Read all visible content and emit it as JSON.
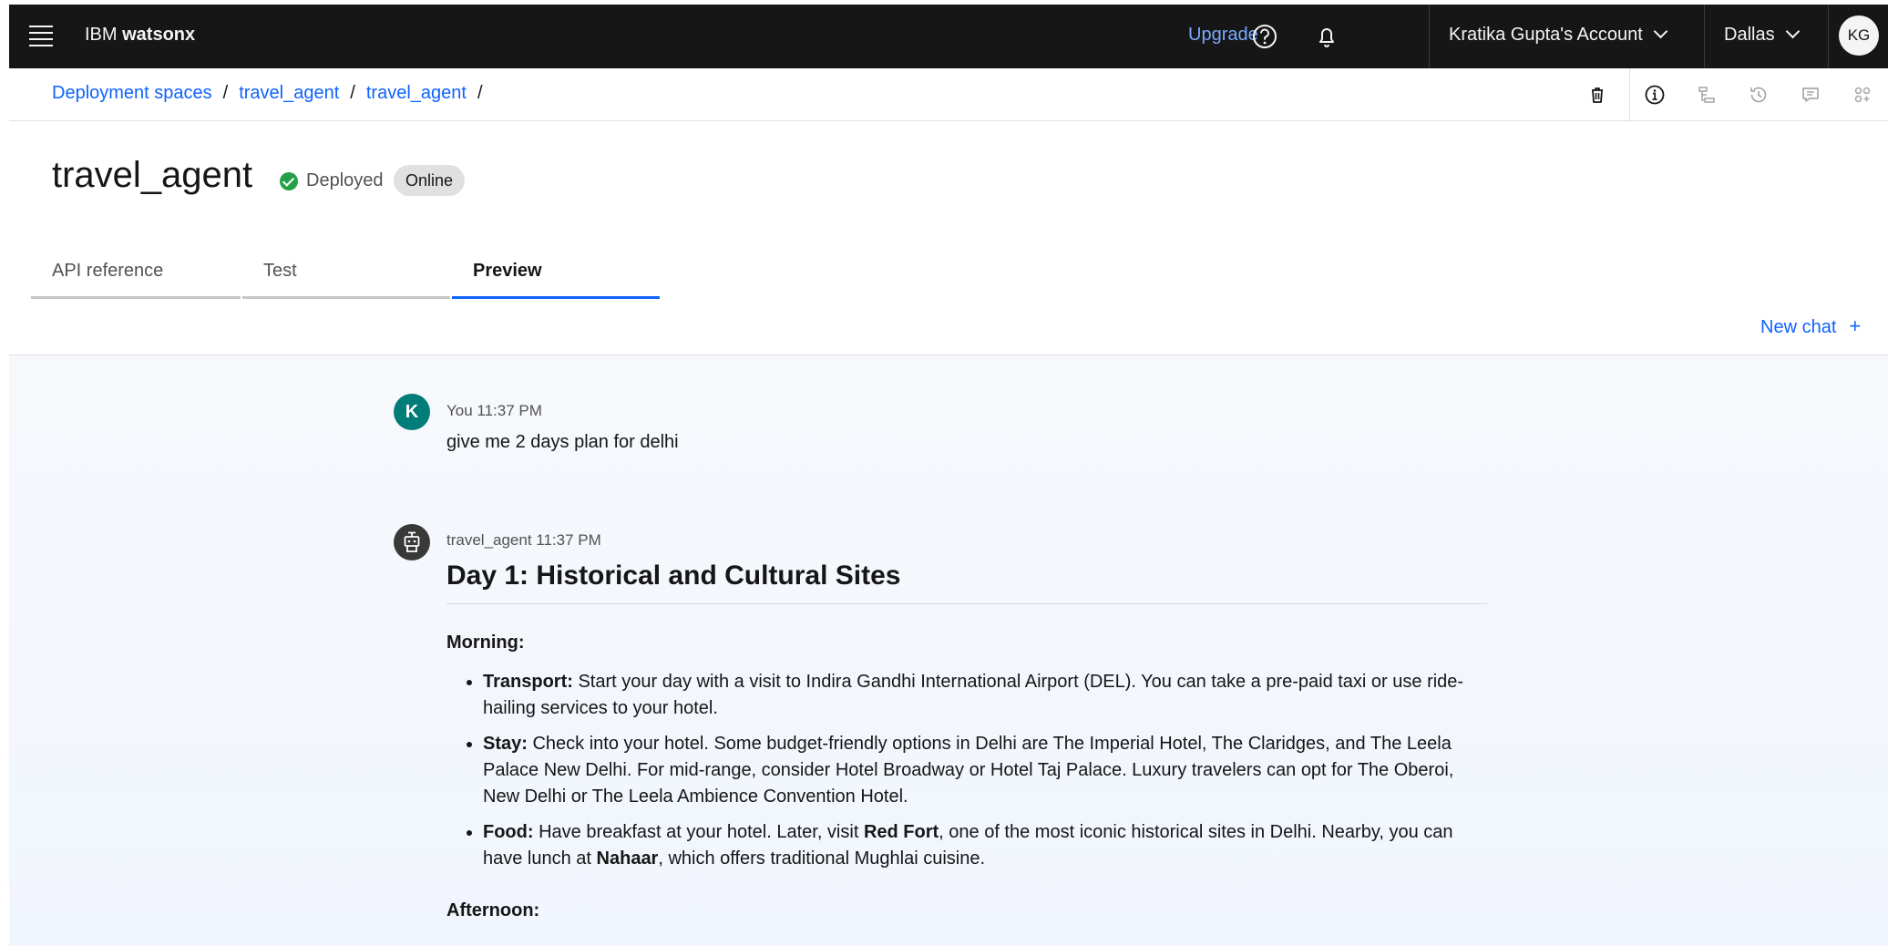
{
  "header": {
    "brand_prefix": "IBM",
    "brand_name": "watsonx",
    "upgrade_label": "Upgrade",
    "account_label": "Kratika Gupta's Account",
    "region_label": "Dallas",
    "avatar_initials": "KG"
  },
  "breadcrumb": {
    "items": [
      "Deployment spaces",
      "travel_agent",
      "travel_agent"
    ],
    "separator": "/"
  },
  "page": {
    "title": "travel_agent",
    "status": "Deployed",
    "tag": "Online"
  },
  "tabs": [
    {
      "label": "API reference",
      "active": false
    },
    {
      "label": "Test",
      "active": false
    },
    {
      "label": "Preview",
      "active": true
    }
  ],
  "new_chat_label": "New chat",
  "chat": {
    "user": {
      "avatar_letter": "K",
      "meta": "You 11:37 PM",
      "text": "give me 2 days plan for delhi"
    },
    "agent": {
      "meta": "travel_agent 11:37 PM",
      "heading": "Day 1: Historical and Cultural Sites",
      "section_morning": "Morning:",
      "items": [
        {
          "label": "Transport:",
          "text": " Start your day with a visit to Indira Gandhi International Airport (DEL). You can take a pre-paid taxi or use ride-hailing services to your hotel."
        },
        {
          "label": "Stay:",
          "text": " Check into your hotel. Some budget-friendly options in Delhi are The Imperial Hotel, The Claridges, and The Leela Palace New Delhi. For mid-range, consider Hotel Broadway or Hotel Taj Palace. Luxury travelers can opt for The Oberoi, New Delhi or The Leela Ambience Convention Hotel."
        },
        {
          "label": "Food:",
          "text_1": " Have breakfast at your hotel. Later, visit ",
          "bold_1": "Red Fort",
          "text_2": ", one of the most iconic historical sites in Delhi. Nearby, you can have lunch at ",
          "bold_2": "Nahaar",
          "text_3": ", which offers traditional Mughlai cuisine."
        }
      ],
      "section_afternoon": "Afternoon:"
    }
  },
  "colors": {
    "shell": "#161616",
    "link": "#0f62fe",
    "upgrade": "#78a9ff",
    "deployed": "#24a148",
    "user_avatar": "#007d79",
    "agent_avatar": "#393939"
  }
}
